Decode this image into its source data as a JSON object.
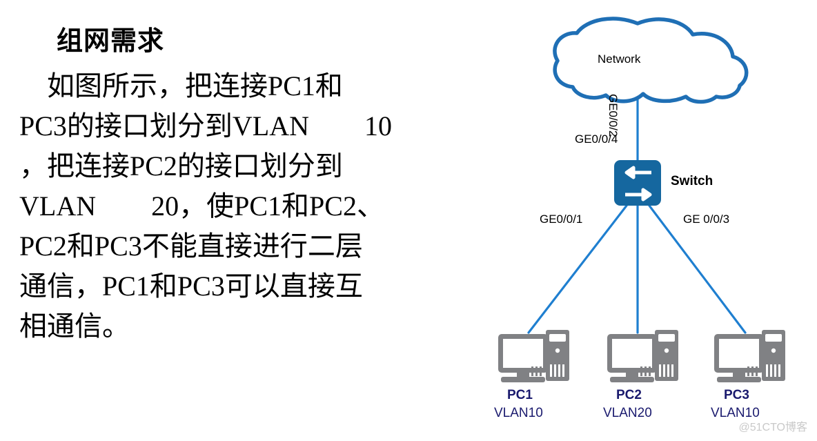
{
  "document": {
    "title": "组网需求",
    "paragraph_lines": [
      "　如图所示，把连接PC1和",
      "PC3的接口划分到VLAN　　10",
      "，把连接PC2的接口划分到",
      "VLAN　　20，使PC1和PC2、",
      "PC2和PC3不能直接进行二层",
      "通信，PC1和PC3可以直接互",
      "相通信。"
    ]
  },
  "diagram": {
    "cloud": {
      "label": "Network"
    },
    "switch": {
      "glyph": "S",
      "name": "Switch"
    },
    "ports": {
      "uplink": "GE0/0/4",
      "pc1": "GE0/0/1",
      "pc2": "GE0/0/2",
      "pc3": "GE 0/0/3"
    },
    "hosts": [
      {
        "name": "PC1",
        "vlan": "VLAN10"
      },
      {
        "name": "PC2",
        "vlan": "VLAN20"
      },
      {
        "name": "PC3",
        "vlan": "VLAN10"
      }
    ],
    "colors": {
      "link_blue": "#1f7fd0",
      "switch_blue": "#15679f",
      "cloud_blue": "#1f6fb5",
      "device_gray": "#808184",
      "label_navy": "#1a1a6e"
    }
  },
  "watermark": {
    "text": "@51CTO博客"
  }
}
